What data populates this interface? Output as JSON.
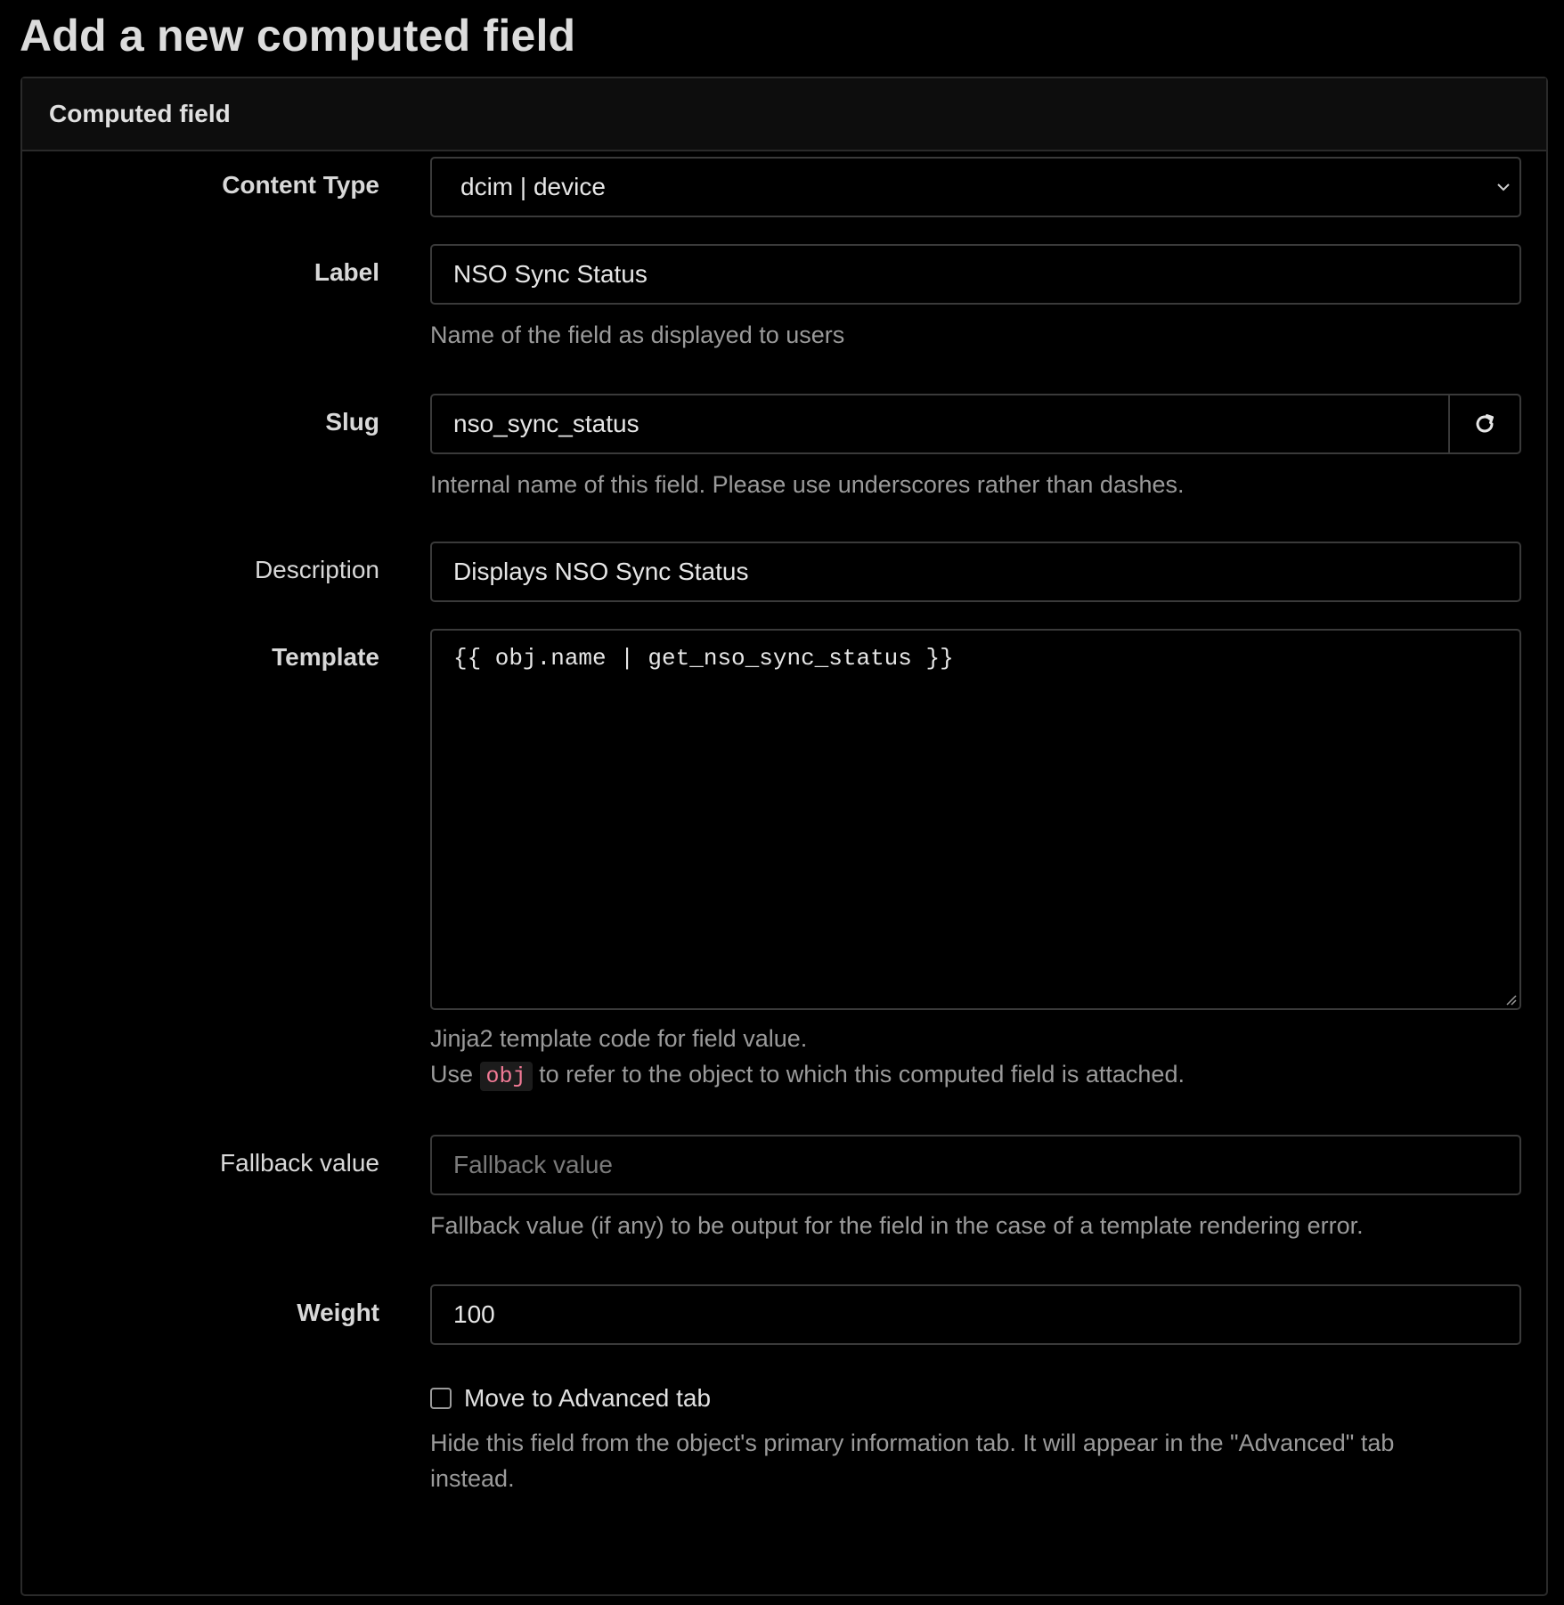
{
  "page": {
    "title": "Add a new computed field"
  },
  "panel": {
    "heading": "Computed field"
  },
  "fields": {
    "content_type": {
      "label": "Content Type",
      "value": "dcim | device"
    },
    "label": {
      "label": "Label",
      "value": "NSO Sync Status",
      "help": "Name of the field as displayed to users"
    },
    "slug": {
      "label": "Slug",
      "value": "nso_sync_status",
      "help": "Internal name of this field. Please use underscores rather than dashes."
    },
    "description": {
      "label": "Description",
      "value": "Displays NSO Sync Status"
    },
    "template": {
      "label": "Template",
      "value": "{{ obj.name | get_nso_sync_status }}",
      "help_line1": "Jinja2 template code for field value.",
      "help_line2_prefix": "Use",
      "help_line2_code": "obj",
      "help_line2_suffix": "to refer to the object to which this computed field is attached."
    },
    "fallback_value": {
      "label": "Fallback value",
      "placeholder": "Fallback value",
      "help": "Fallback value (if any) to be output for the field in the case of a template rendering error."
    },
    "weight": {
      "label": "Weight",
      "value": "100"
    },
    "advanced_ui": {
      "label": "Move to Advanced tab",
      "checked": false,
      "help": "Hide this field from the object's primary information tab. It will appear in the \"Advanced\" tab instead."
    }
  },
  "icons": {
    "select_chevron": "chevron-down-icon",
    "slug_regenerate": "refresh-icon",
    "textarea_resize": "resize-grip-icon"
  },
  "colors": {
    "background": "#000000",
    "panel_border": "#2a2a2a",
    "input_border": "#3a3a3a",
    "help_text": "#9a9a9a",
    "code_inline": "#f27a96"
  }
}
